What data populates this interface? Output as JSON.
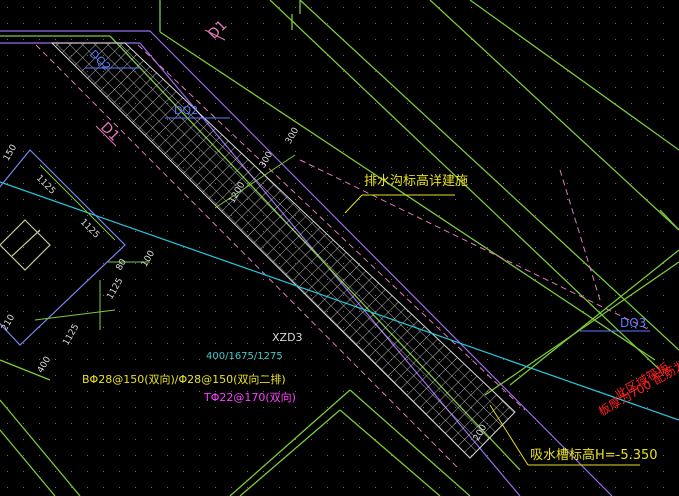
{
  "colors": {
    "background": "#000000",
    "wall_green": "#7cc93a",
    "hatch_white": "#d8d8d8",
    "purple": "#9b6cf0",
    "pink_dashed": "#e07ab8",
    "cyan": "#28c8e0",
    "yellow": "#e8e020",
    "red": "#ff2020",
    "magenta": "#ff40ff",
    "blue_label": "#8aa0ff",
    "teal_label": "#44c8c8"
  },
  "labels": {
    "dq2_top": "DQ2",
    "dq2_mid": "DQ2",
    "dq3": "DQ3",
    "d1_top": "D1",
    "d1_left": "D1",
    "drain_note": "排水沟标高详建施",
    "sump_note": "吸水槽标高H=-5.350",
    "red_note_1": "此区域筏板",
    "red_note_2": "板厚为700 配筋为",
    "xzd3": "XZD3",
    "xzd3_dims": "400/1675/1275",
    "xzd3_rebar_b": "BΦ28@150(双向)/Φ28@150(双向二排)",
    "xzd3_rebar_t": "TΦ22@170(双向)",
    "dim_1200": "1200",
    "dim_300a": "300",
    "dim_300b": "300",
    "dim_1125a": "1125",
    "dim_1125b": "1125",
    "dim_1125c": "1125",
    "dim_1125d": "1125",
    "dim_150": "150",
    "dim_100": "100",
    "dim_80": "80",
    "dim_210": "210",
    "dim_400": "400",
    "dim_200": "200",
    "dim_100b": "100"
  }
}
